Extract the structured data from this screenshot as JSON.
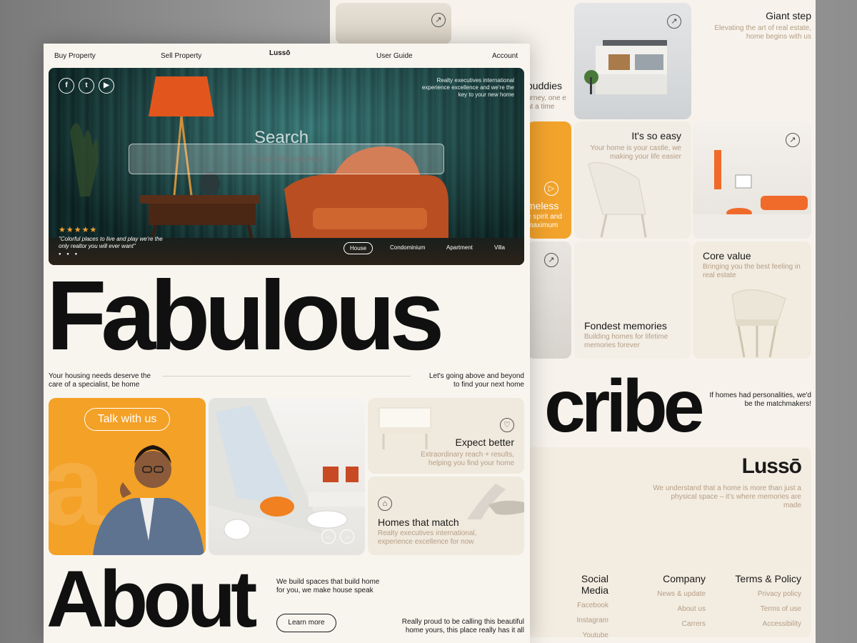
{
  "nav": {
    "buy": "Buy Property",
    "sell": "Sell Property",
    "logo": "Lussō",
    "guide": "User Guide",
    "account": "Account"
  },
  "hero": {
    "search_title": "Search",
    "search_placeholder": "Search Property Now",
    "tagline": "Realty executives international experience excellence and we're the key to your new home",
    "rating": "★★★★★",
    "quote": "\"Colorful places to live and play we're the only realtor you will ever want\"",
    "tabs": [
      "House",
      "Condominium",
      "Apartment",
      "Villa"
    ],
    "active_tab": "House"
  },
  "headline": "Fabulous",
  "sub_left": "Your housing needs deserve the care of a specialist, be home",
  "sub_right": "Let's going above and beyond to find your next home",
  "cards": {
    "talk": "Talk with us",
    "expect_title": "Expect better",
    "expect_sub": "Extraordinary reach + results, helping you find your home",
    "match_title": "Homes that match",
    "match_sub": "Realty executives international, experience excellence for now"
  },
  "about": {
    "title": "About",
    "desc": "We build spaces that build home for you, we make house speak",
    "cta": "Learn more",
    "proud": "Really proud to be calling this beautiful home yours, this place really has it all"
  },
  "back": {
    "giant_title": "Giant step",
    "giant_sub": "Elevating the art of real estate, home begins with us",
    "buddies_title": "buddies",
    "buddies_sub": "urney, one e at a time",
    "easy_title": "It's so easy",
    "easy_sub": "Your home is your castle, we making your life easier",
    "timeless_title": "meless",
    "timeless_sub": "e spirit and maximum",
    "core_title": "Core value",
    "core_sub": "Bringing you the best feeling in real estate",
    "fond_title": "Fondest memories",
    "fond_sub": "Building homes for lifetime memories forever",
    "describe_partial": "cribe",
    "personality": "If homes had personalities, we'd be the matchmakers!",
    "footer_logo": "Lussō",
    "footer_desc": "We understand that a home is more than just a physical space – it's where memories are made",
    "col_social": "Social Media",
    "col_company": "Company",
    "col_terms": "Terms & Policy",
    "social_links": [
      "Facebook",
      "Instagram",
      "Youtube"
    ],
    "company_links": [
      "News & update",
      "About us",
      "Carrers"
    ],
    "terms_links": [
      "Privacy policy",
      "Terms of use",
      "Accessibility"
    ]
  },
  "colors": {
    "accent": "#f4a127",
    "cream": "#f0e9dd",
    "muted": "#b59e85",
    "teal": "#245e5c"
  }
}
